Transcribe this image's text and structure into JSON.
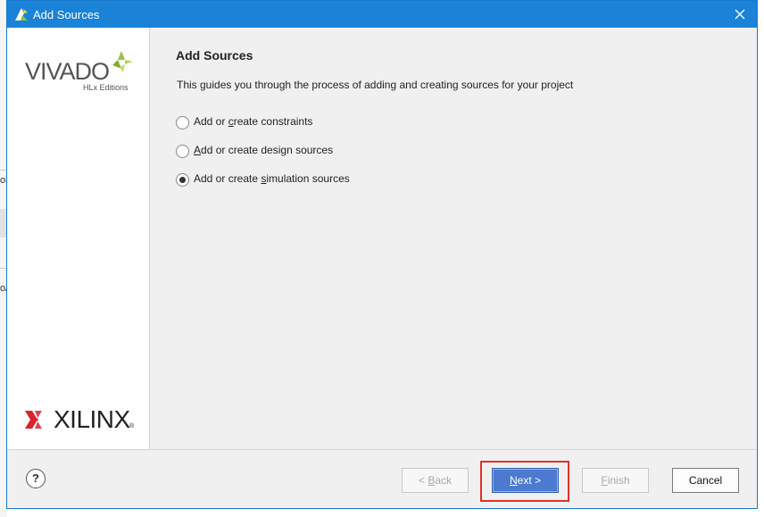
{
  "window": {
    "title": "Add Sources"
  },
  "branding": {
    "product": "VIVADO",
    "edition": "HLx Editions",
    "vendor": "XILINX",
    "vendor_mark": "®"
  },
  "page": {
    "heading": "Add Sources",
    "description": "This guides you through the process of adding and creating sources for your project"
  },
  "options": [
    {
      "pre": "Add or ",
      "key": "c",
      "post": "reate constraints",
      "selected": false
    },
    {
      "pre": "",
      "key": "A",
      "post": "dd or create design sources",
      "selected": false
    },
    {
      "pre": "Add or create ",
      "key": "s",
      "post": "imulation sources",
      "selected": true
    }
  ],
  "buttons": {
    "help": "?",
    "back": {
      "pre": "< ",
      "key": "B",
      "post": "ack",
      "enabled": false
    },
    "next": {
      "pre": "",
      "key": "N",
      "post": "ext >",
      "enabled": true
    },
    "finish": {
      "pre": "",
      "key": "F",
      "post": "inish",
      "enabled": false
    },
    "cancel": "Cancel"
  },
  "background": {
    "frag1": "oi",
    "frag2": "o/"
  },
  "colors": {
    "titlebar": "#1a82d7",
    "primary_button": "#4b7ad0",
    "highlight": "#e0312c",
    "leaf": "#9bc23c"
  }
}
